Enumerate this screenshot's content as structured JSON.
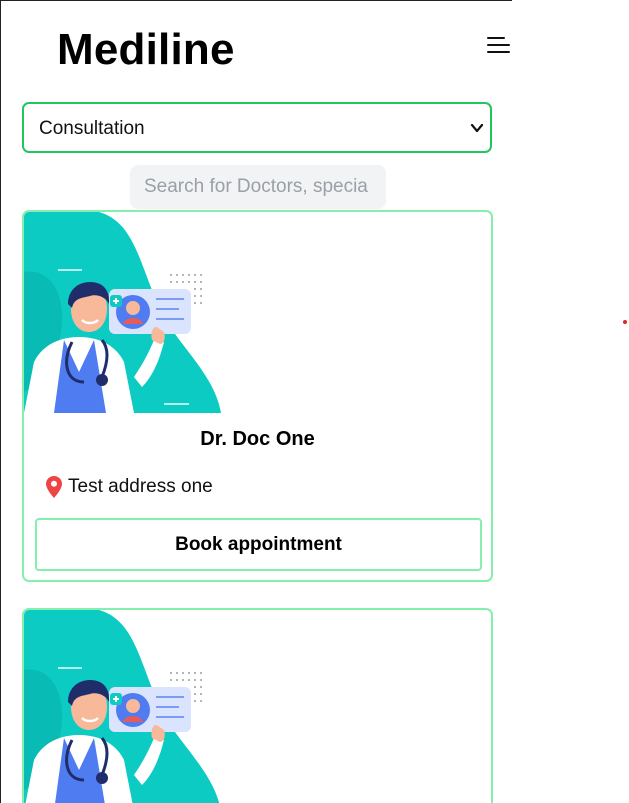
{
  "header": {
    "brand": "Mediline",
    "menu_icon": "hamburger-menu-icon"
  },
  "filter": {
    "selected": "Consultation",
    "icon": "chevron-down-icon"
  },
  "search": {
    "placeholder": "Search for Doctors, specia"
  },
  "colors": {
    "accent": "#22c55e",
    "card_border": "#86efac",
    "illustration_teal": "#0ccbc3",
    "pin": "#ef4444"
  },
  "doctors": [
    {
      "name": "Dr. Doc One",
      "address": "Test address one",
      "book_label": "Book appointment",
      "address_icon": "location-pin-icon",
      "image": "doctor-illustration"
    },
    {
      "image": "doctor-illustration"
    }
  ]
}
